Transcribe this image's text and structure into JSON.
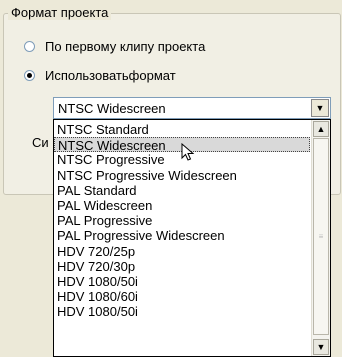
{
  "group": {
    "title": "Формат проекта"
  },
  "options": [
    {
      "label": "По первому клипу проекта",
      "checked": false
    },
    {
      "label": "Использоватьформат",
      "checked": true
    }
  ],
  "combo": {
    "value": "NTSC Widescreen"
  },
  "side_label": "Си",
  "dropdown": {
    "selected_index": 1,
    "items": [
      "NTSC Standard",
      "NTSC Widescreen",
      "NTSC Progressive",
      "NTSC Progressive Widescreen",
      "PAL Standard",
      "PAL Widescreen",
      "PAL Progressive",
      "PAL Progressive Widescreen",
      "HDV 720/25p",
      "HDV 720/30p",
      "HDV 1080/50i",
      "HDV 1080/60i",
      "HDV 1080/50i"
    ]
  },
  "icons": {
    "scroll_up": "scroll-up-arrow-icon",
    "scroll_down": "scroll-down-arrow-icon",
    "combo_arrow": "chevron-down-icon",
    "cursor": "mouse-pointer-icon"
  }
}
